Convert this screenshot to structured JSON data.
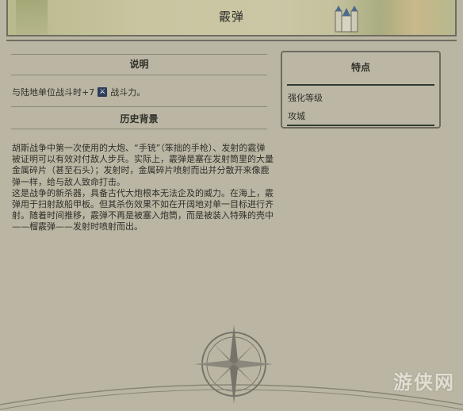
{
  "header": {
    "title": "霰弹"
  },
  "description": {
    "heading": "说明",
    "text_before": "与陆地单位战斗时+7",
    "icon": "sword-icon",
    "text_after": "战斗力。"
  },
  "history": {
    "heading": "历史背景",
    "paragraphs": [
      "胡斯战争中第一次使用的大炮、“手铳”（笨拙的手枪）、发射的霰弹被证明可以有效对付敌人步兵。实际上，霰弹是塞在发射筒里的大量金属碎片（甚至石头）；发射时，金属碎片喷射而出并分散开来像鹿弹一样，给与敌人致命打击。",
      "这是战争的新杀器，具备古代大炮根本无法企及的威力。在海上，霰弹用于扫射敌船甲板。但其杀伤效果不如在开阔地对单一目标进行齐射。随着时间推移，霰弹不再是被塞入炮筒，而是被装入特殊的壳中——榴霰弹——发射时喷射而出。"
    ]
  },
  "traits": {
    "heading": "特点",
    "items": [
      "强化等级",
      "攻城"
    ]
  },
  "watermark": "游侠网",
  "colors": {
    "background": "#bdb8a6",
    "text": "#2f2f2a",
    "trait_bar": "#2f3b2f",
    "icon_bg": "#2b3e5a"
  }
}
